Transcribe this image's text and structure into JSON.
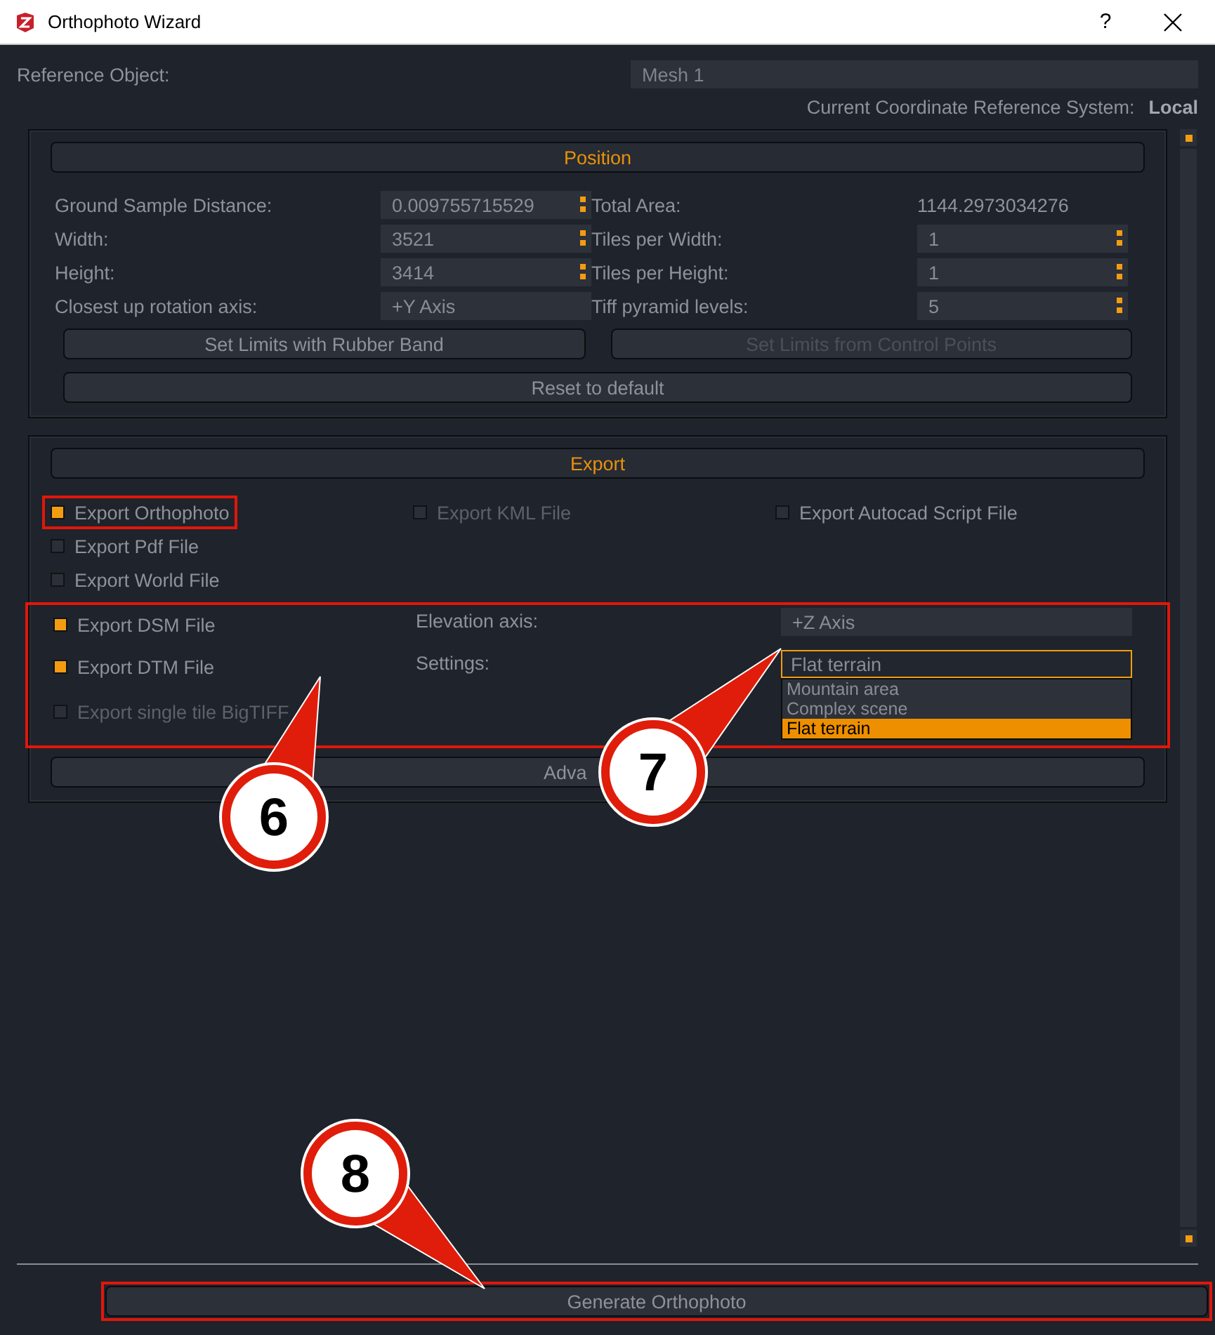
{
  "window": {
    "title": "Orthophoto Wizard",
    "help": "?"
  },
  "reference_object": {
    "label": "Reference Object:",
    "value": "Mesh 1"
  },
  "crs": {
    "label": "Current Coordinate Reference System:",
    "value": "Local"
  },
  "position": {
    "title": "Position",
    "fields": [
      {
        "label": "Ground Sample Distance:",
        "value": "0.009755715529",
        "kind": "spin"
      },
      {
        "label": "Total Area:",
        "value": "1144.2973034276",
        "kind": "text"
      },
      {
        "label": "Width:",
        "value": "3521",
        "kind": "spin"
      },
      {
        "label": "Tiles per Width:",
        "value": "1",
        "kind": "spin"
      },
      {
        "label": "Height:",
        "value": "3414",
        "kind": "spin"
      },
      {
        "label": "Tiles per Height:",
        "value": "1",
        "kind": "spin"
      },
      {
        "label": "Closest up rotation axis:",
        "value": "+Y Axis",
        "kind": "combo"
      },
      {
        "label": "Tiff pyramid levels:",
        "value": "5",
        "kind": "spin"
      }
    ],
    "buttons": [
      {
        "label": "Set Limits with Rubber Band",
        "disabled": false
      },
      {
        "label": "Set Limits from Control Points",
        "disabled": true
      },
      {
        "label": "Reset to default",
        "disabled": false
      }
    ]
  },
  "export": {
    "title": "Export",
    "options": [
      {
        "label": "Export Orthophoto",
        "checked": true,
        "disabled": false,
        "highlighted": true
      },
      {
        "label": "Export KML File",
        "checked": false,
        "disabled": true,
        "highlighted": false
      },
      {
        "label": "Export Autocad Script File",
        "checked": false,
        "disabled": false,
        "highlighted": false
      },
      {
        "label": "Export Pdf File",
        "checked": false,
        "disabled": false,
        "highlighted": false
      },
      {
        "label": "Export World File",
        "checked": false,
        "disabled": false,
        "highlighted": false
      }
    ],
    "elevation": {
      "highlighted": true,
      "dsm": {
        "label": "Export DSM File",
        "checked": true
      },
      "dtm": {
        "label": "Export DTM File",
        "checked": true
      },
      "bigtiff": {
        "label": "Export single tile BigTIFF",
        "checked": false,
        "disabled": true
      },
      "axis": {
        "label": "Elevation axis:",
        "value": "+Z Axis"
      },
      "settings": {
        "label": "Settings:",
        "value": "Flat terrain",
        "expanded": true,
        "options": [
          {
            "label": "Mountain area",
            "selected": false
          },
          {
            "label": "Complex scene",
            "selected": false
          },
          {
            "label": "Flat terrain",
            "selected": true
          }
        ]
      }
    },
    "advanced": "Adva"
  },
  "generate": {
    "label": "Generate Orthophoto",
    "highlighted": true
  },
  "callouts": [
    {
      "number": "6"
    },
    {
      "number": "7"
    },
    {
      "number": "8"
    }
  ]
}
